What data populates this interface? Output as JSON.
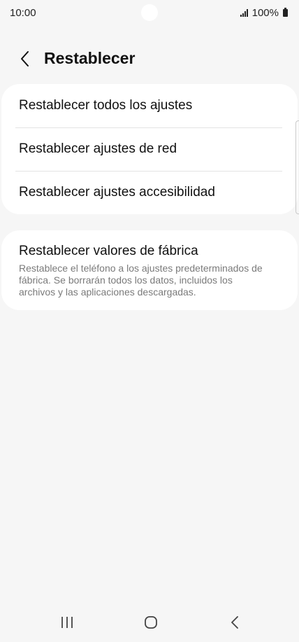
{
  "status_bar": {
    "time": "10:00",
    "battery": "100%",
    "icons": [
      "signal-icon",
      "battery-icon"
    ]
  },
  "header": {
    "title": "Restablecer",
    "back_icon": "chevron-left-icon"
  },
  "reset_options": [
    {
      "label": "Restablecer todos los ajustes"
    },
    {
      "label": "Restablecer ajustes de red"
    },
    {
      "label": "Restablecer ajustes accesibilidad"
    }
  ],
  "factory_reset": {
    "title": "Restablecer valores de fábrica",
    "description": "Restablece el teléfono a los ajustes predeterminados de fábrica. Se borrarán todos los datos, incluidos los archivos y las aplicaciones descargadas."
  },
  "navigation_bar": {
    "icons": [
      "recent-apps-icon",
      "home-icon",
      "back-icon"
    ]
  },
  "colors": {
    "background": "#f6f6f6",
    "card": "#ffffff",
    "text": "#111111",
    "secondary_text": "#7a7a7a",
    "divider": "#e3e3e3"
  }
}
